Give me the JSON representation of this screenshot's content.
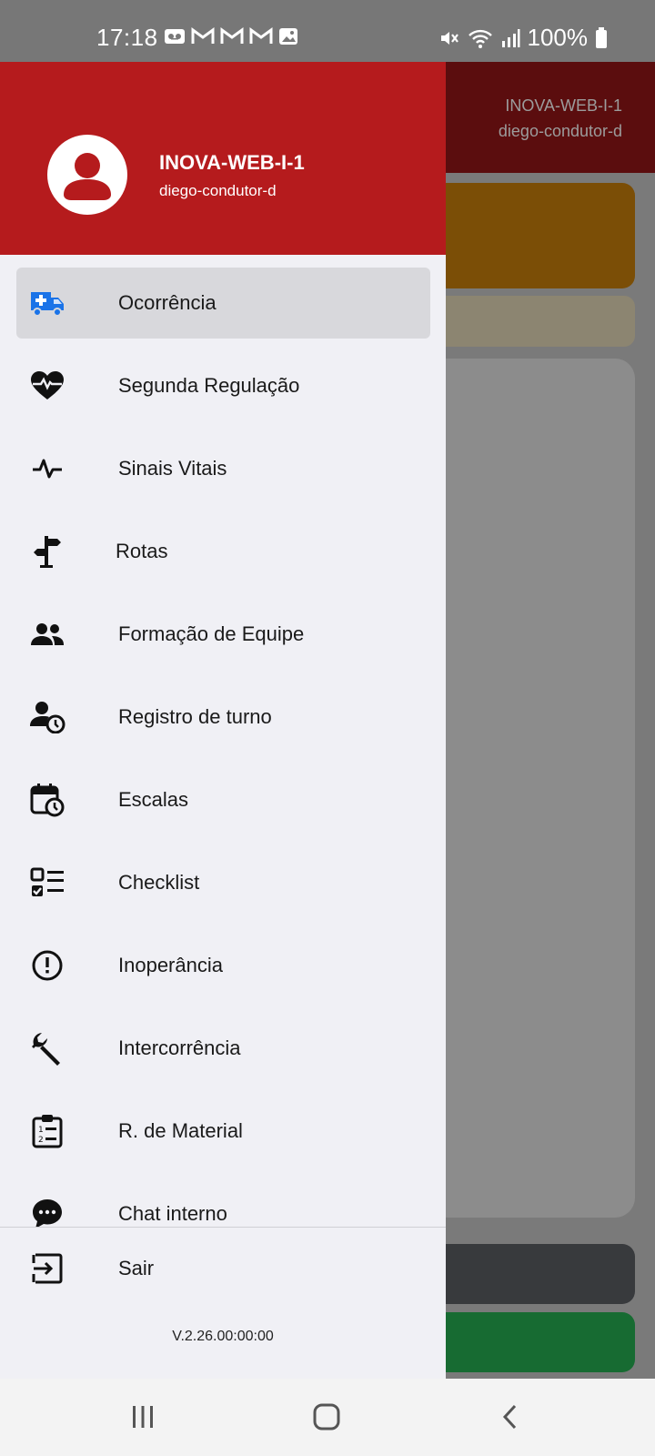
{
  "status_bar": {
    "time": "17:18",
    "battery": "100%",
    "left_icons": [
      "voicemail-icon",
      "gmail-icon",
      "gmail-icon",
      "gmail-icon",
      "image-icon"
    ],
    "right_icons": [
      "mute-icon",
      "wifi-icon",
      "signal-icon",
      "battery-icon"
    ]
  },
  "background_app": {
    "header_title": "INOVA-WEB-I-1",
    "header_subtitle": "diego-condutor-d"
  },
  "drawer": {
    "title": "INOVA-WEB-I-1",
    "subtitle": "diego-condutor-d",
    "menu": [
      {
        "label": "Ocorrência",
        "icon": "ambulance-icon",
        "active": true
      },
      {
        "label": "Segunda Regulação",
        "icon": "heart-pulse-icon"
      },
      {
        "label": "Sinais Vitais",
        "icon": "pulse-icon"
      },
      {
        "label": "Rotas",
        "icon": "signpost-icon"
      },
      {
        "label": "Formação de Equipe",
        "icon": "people-icon"
      },
      {
        "label": "Registro de turno",
        "icon": "person-clock-icon"
      },
      {
        "label": "Escalas",
        "icon": "calendar-clock-icon"
      },
      {
        "label": "Checklist",
        "icon": "checklist-icon"
      },
      {
        "label": "Inoperância",
        "icon": "alert-circle-icon"
      },
      {
        "label": "Intercorrência",
        "icon": "wrench-icon"
      },
      {
        "label": "R. de Material",
        "icon": "clipboard-list-icon"
      },
      {
        "label": "Chat interno",
        "icon": "chat-icon"
      }
    ],
    "logout_label": "Sair",
    "version": "V.2.26.00:00:00"
  },
  "colors": {
    "header_red": "#b51b1d",
    "drawer_bg": "#f0f0f5",
    "active_item_bg": "#d8d8dc",
    "ambulance_blue": "#1a73e8"
  }
}
